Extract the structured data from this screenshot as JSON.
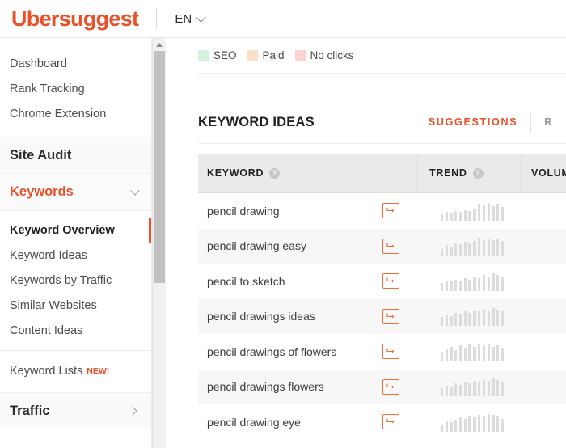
{
  "header": {
    "logo": "Ubersuggest",
    "language": "EN",
    "chevron_icon": "chevron-down-icon"
  },
  "sidebar": {
    "top_items": [
      {
        "label": "Dashboard"
      },
      {
        "label": "Rank Tracking"
      },
      {
        "label": "Chrome Extension"
      }
    ],
    "groups": [
      {
        "label": "Site Audit",
        "expanded": false,
        "accent": false,
        "chevron": ""
      },
      {
        "label": "Keywords",
        "expanded": true,
        "accent": true,
        "chevron": "chevron-down-icon"
      }
    ],
    "keyword_subitems": [
      {
        "label": "Keyword Overview",
        "active": true
      },
      {
        "label": "Keyword Ideas",
        "active": false
      },
      {
        "label": "Keywords by Traffic",
        "active": false
      },
      {
        "label": "Similar Websites",
        "active": false
      },
      {
        "label": "Content Ideas",
        "active": false
      }
    ],
    "keyword_lists": {
      "label": "Keyword Lists",
      "badge": "NEW!"
    },
    "traffic_group": {
      "label": "Traffic",
      "chevron": "chevron-right-icon"
    },
    "scrollbar": {
      "arrow_icon": "scroll-up-arrow-icon"
    }
  },
  "main": {
    "legend": [
      {
        "label": "SEO",
        "color": "#d4f0df"
      },
      {
        "label": "Paid",
        "color": "#fbdfc9"
      },
      {
        "label": "No clicks",
        "color": "#fbd2d2"
      }
    ],
    "section_title": "KEYWORD IDEAS",
    "tabs": [
      {
        "label": "SUGGESTIONS",
        "active": true
      },
      {
        "label": "R",
        "active": false
      }
    ],
    "table": {
      "columns": [
        {
          "label": "KEYWORD",
          "help": "?"
        },
        {
          "label": "TREND",
          "help": "?"
        },
        {
          "label": "VOLUM",
          "help": ""
        }
      ],
      "rows": [
        {
          "keyword": "pencil drawing",
          "action_icon": "arrow-right-icon",
          "trend": [
            6,
            8,
            7,
            9,
            8,
            10,
            9,
            11,
            16,
            15,
            17,
            14,
            16,
            13
          ],
          "volume_partial": ""
        },
        {
          "keyword": "pencil drawing easy",
          "action_icon": "arrow-right-icon",
          "trend": [
            7,
            11,
            9,
            13,
            12,
            14,
            13,
            15,
            18,
            16,
            17,
            16,
            17,
            15
          ],
          "volume_partial": ""
        },
        {
          "keyword": "pencil to sketch",
          "action_icon": "arrow-right-icon",
          "trend": [
            5,
            6,
            6,
            7,
            6,
            8,
            7,
            9,
            8,
            10,
            9,
            11,
            10,
            9
          ],
          "volume_partial": ""
        },
        {
          "keyword": "pencil drawings ideas",
          "action_icon": "arrow-right-icon",
          "trend": [
            8,
            10,
            9,
            12,
            11,
            13,
            12,
            14,
            13,
            15,
            14,
            16,
            15,
            13
          ],
          "volume_partial": ""
        },
        {
          "keyword": "pencil drawings of flowers",
          "action_icon": "arrow-right-icon",
          "trend": [
            9,
            12,
            14,
            11,
            15,
            13,
            16,
            14,
            17,
            15,
            16,
            14,
            15,
            13
          ],
          "volume_partial": ""
        },
        {
          "keyword": "pencil drawings flowers",
          "action_icon": "arrow-right-icon",
          "trend": [
            7,
            9,
            8,
            11,
            10,
            12,
            11,
            13,
            12,
            14,
            13,
            15,
            14,
            12
          ],
          "volume_partial": ""
        },
        {
          "keyword": "pencil drawing eye",
          "action_icon": "arrow-right-icon",
          "trend": [
            6,
            9,
            8,
            10,
            12,
            11,
            13,
            12,
            14,
            13,
            15,
            14,
            13,
            11
          ],
          "volume_partial": ""
        }
      ]
    }
  }
}
